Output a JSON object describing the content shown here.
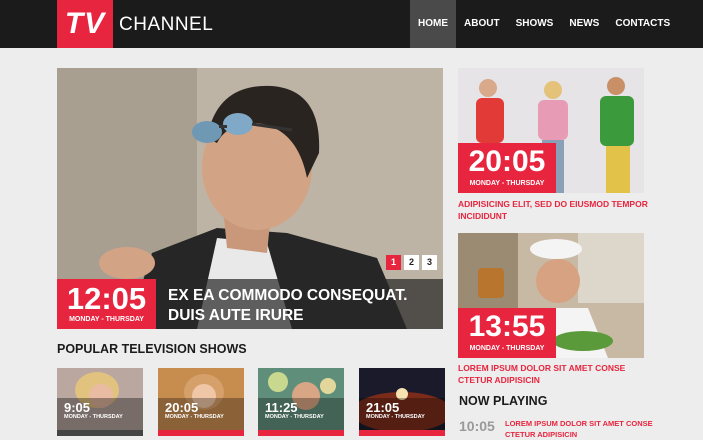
{
  "header": {
    "logo_tv": "TV",
    "logo_channel": "CHANNEL",
    "nav": [
      "HOME",
      "ABOUT",
      "SHOWS",
      "NEWS",
      "CONTACTS"
    ]
  },
  "hero": {
    "time": "12:05",
    "day": "MONDAY - THURSDAY",
    "title": "EX EA COMMODO CONSEQUAT. DUIS AUTE IRURE",
    "pager": [
      "1",
      "2",
      "3"
    ]
  },
  "side_cards": [
    {
      "time": "20:05",
      "day": "MONDAY - THURSDAY",
      "caption": "ADIPISICING ELIT, SED DO EIUSMOD TEMPOR INCIDIDUNT"
    },
    {
      "time": "13:55",
      "day": "MONDAY - THURSDAY",
      "caption": "LOREM IPSUM DOLOR SIT AMET CONSE CTETUR ADIPISICIN"
    }
  ],
  "popular": {
    "title": "POPULAR TELEVISION SHOWS",
    "shows": [
      {
        "time": "9:05",
        "day": "MONDAY - THURSDAY"
      },
      {
        "time": "20:05",
        "day": "MONDAY - THURSDAY"
      },
      {
        "time": "11:25",
        "day": "MONDAY - THURSDAY"
      },
      {
        "time": "21:05",
        "day": "MONDAY - THURSDAY"
      }
    ]
  },
  "now_playing": {
    "title": "NOW PLAYING",
    "time": "10:05",
    "text": "LOREM IPSUM DOLOR SIT AMET CONSE CTETUR ADIPISICIN"
  },
  "colors": {
    "accent": "#e8253f",
    "header": "#1b1b1b",
    "background": "#ededed"
  }
}
